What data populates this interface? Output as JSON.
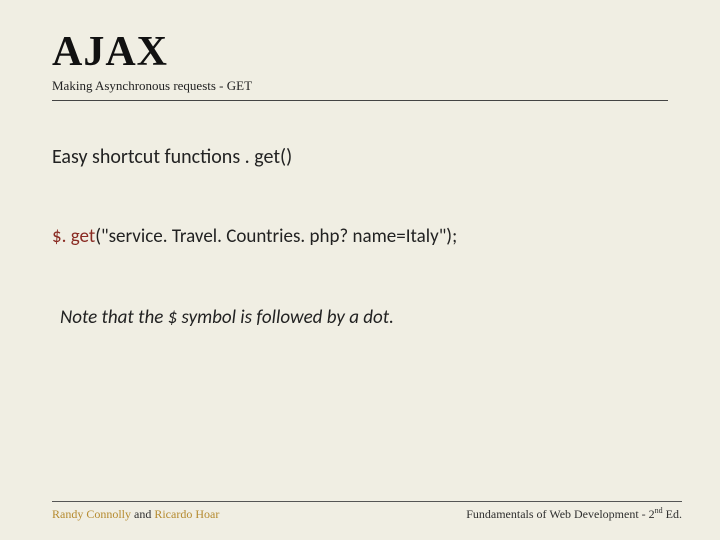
{
  "header": {
    "title": "AJAX",
    "subtitle": "Making Asynchronous requests - GET"
  },
  "body": {
    "line1": "Easy shortcut functions . get()",
    "code_fn": "$. get",
    "code_arg": "(\"service. Travel. Countries. php? name=Italy\");",
    "note": "Note that the $ symbol is followed by a dot."
  },
  "footer": {
    "author1": "Randy Connolly",
    "and": " and ",
    "author2": "Ricardo Hoar",
    "right_prefix": "Fundamentals of Web Development - 2",
    "right_sup": "nd",
    "right_suffix": " Ed."
  }
}
